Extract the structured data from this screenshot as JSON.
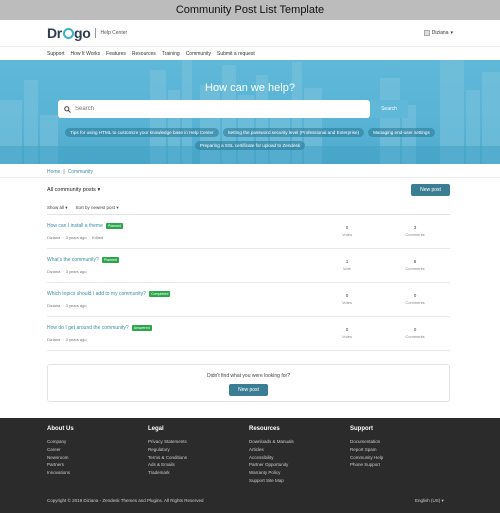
{
  "window": {
    "title": "Community Post List Template"
  },
  "header": {
    "logo_text": "Dr",
    "logo_text_end": "go",
    "product": "Help Center",
    "user_name": "Diziana"
  },
  "nav": {
    "items": [
      {
        "label": "Support"
      },
      {
        "label": "How It Works"
      },
      {
        "label": "Features"
      },
      {
        "label": "Resources"
      },
      {
        "label": "Training"
      },
      {
        "label": "Community"
      },
      {
        "label": "Submit a request"
      }
    ]
  },
  "hero": {
    "title": "How can we help?",
    "search_placeholder": "Search",
    "search_button": "Search",
    "promoted": [
      {
        "label": "Tips for using HTML to customize your knowledge base in Help Center"
      },
      {
        "label": "Setting the password security level (Professional and Enterprise)"
      },
      {
        "label": "Managing end-user settings"
      },
      {
        "label": "Preparing a SSL certificate for upload to Zendesk"
      }
    ]
  },
  "breadcrumb": {
    "home": "Home",
    "separator": "|",
    "current": "Community"
  },
  "list": {
    "filter": "All community posts",
    "new_post": "New post",
    "show_all": "Show all",
    "sort": "Sort by newest post",
    "posts": [
      {
        "title": "How can I install a theme",
        "badge": "Planned",
        "badge_color": "#2ba64b",
        "author": "Diziana",
        "age": "3 years ago",
        "edited": "Edited",
        "votes": "0",
        "votes_label": "Votes",
        "comments": "3",
        "comments_label": "Comments"
      },
      {
        "title": "What's the community?",
        "badge": "Planned",
        "badge_color": "#2ba64b",
        "author": "Diziana",
        "age": "3 years ago",
        "edited": "",
        "votes": "1",
        "votes_label": "Vote",
        "comments": "6",
        "comments_label": "Comments"
      },
      {
        "title": "Which topics should I add to my community?",
        "badge": "Completed",
        "badge_color": "#2ba64b",
        "author": "Diziana",
        "age": "3 years ago",
        "edited": "",
        "votes": "0",
        "votes_label": "Votes",
        "comments": "0",
        "comments_label": "Comments"
      },
      {
        "title": "How do I get around the community?",
        "badge": "Answered",
        "badge_color": "#2ba64b",
        "author": "Diziana",
        "age": "3 years ago",
        "edited": "",
        "votes": "0",
        "votes_label": "Votes",
        "comments": "0",
        "comments_label": "Comments"
      }
    ]
  },
  "cta": {
    "text": "Didn't find what you were looking for?",
    "button": "New post"
  },
  "footer": {
    "columns": [
      {
        "title": "About Us",
        "links": [
          "Company",
          "Career",
          "Newsroom",
          "Partners",
          "Innovations"
        ]
      },
      {
        "title": "Legal",
        "links": [
          "Privacy Statements",
          "Regulatory",
          "Terms & Conditions",
          "Ads & Emails",
          "Trademark"
        ]
      },
      {
        "title": "Resources",
        "links": [
          "Downloads & Manuals",
          "Articles",
          "Accessibility",
          "Partner Opportunity",
          "Warranty Policy",
          "Support Site Map"
        ]
      },
      {
        "title": "Support",
        "links": [
          "Documentation",
          "Report Spam",
          "Community Help",
          "Phone Support"
        ]
      }
    ],
    "copyright": "Copyright © 2019 Diziana - Zendesk Themes and Plugins. All Rights Reserved",
    "language": "English (US)"
  },
  "colors": {
    "accent": "#3b7e94",
    "hero": "#5fb8d8",
    "badge": "#2ba64b",
    "footer": "#2b2b2b"
  },
  "icons": {
    "search": "search-icon",
    "chevron": "chevron-down-icon",
    "avatar": "avatar-icon"
  }
}
